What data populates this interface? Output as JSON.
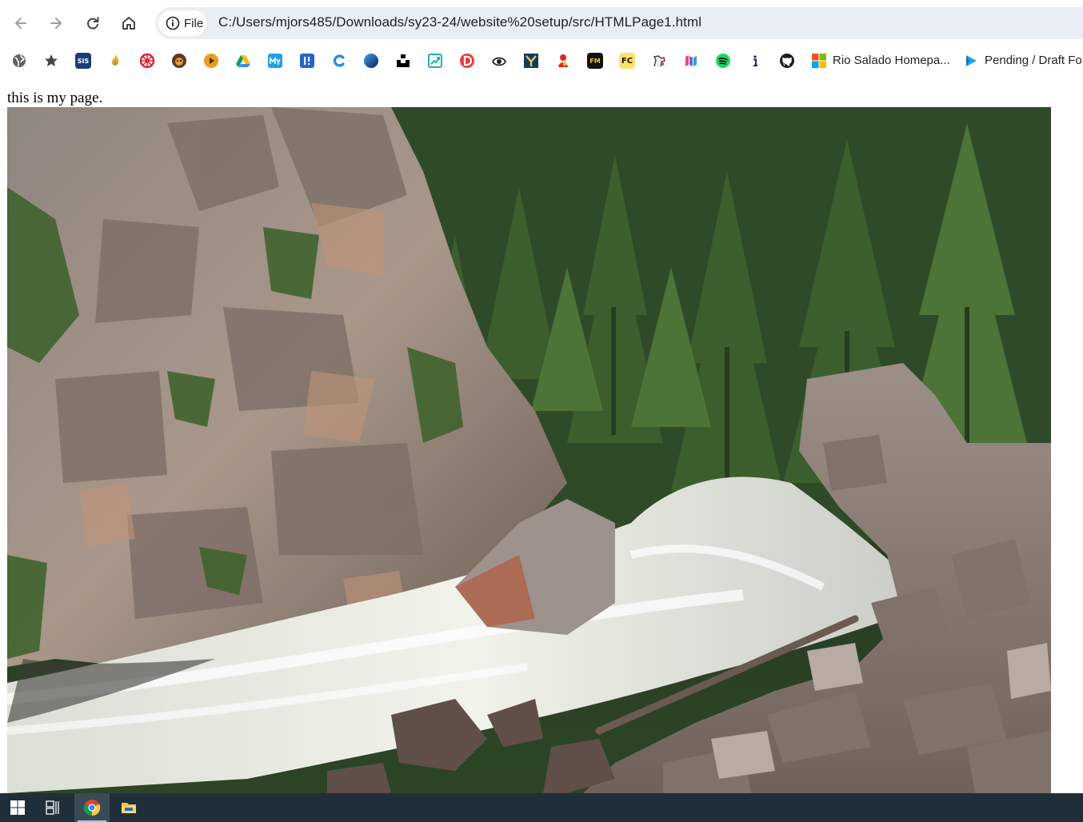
{
  "browser": {
    "nav": {
      "back_icon": "arrow-left-icon",
      "forward_icon": "arrow-right-icon",
      "reload_icon": "reload-icon",
      "home_icon": "home-icon"
    },
    "omnibox": {
      "chip_icon": "info-icon",
      "chip_label": "File",
      "url": "C:/Users/mjors485/Downloads/sy23-24/website%20setup/src/HTMLPage1.html"
    },
    "bookmarks": {
      "icons": [
        "globe-icon",
        "star-icon",
        "sis-icon",
        "flame-icon",
        "wheel-icon",
        "dog-icon",
        "play-icon",
        "google-drive-icon",
        "my-icon",
        "i-icon",
        "c-icon",
        "blue-circle-icon",
        "unsplash-icon",
        "chart-icon",
        "d-icon",
        "eye-icon",
        "y-icon",
        "red-figure-icon",
        "fm-icon",
        "fc-icon",
        "horse-icon",
        "m-icon",
        "spotify-icon",
        "info-icon",
        "github-icon"
      ],
      "sis_label": "SIS",
      "fm_label": "FM",
      "fc_label": "FC",
      "rio_label": "Rio Salado Homepa...",
      "pending_label": "Pending / Draft Fo"
    }
  },
  "page": {
    "text": "this is my page.",
    "image": "mountain-river-photo"
  },
  "taskbar": {
    "items": [
      "windows-start-icon",
      "task-view-icon",
      "chrome-icon",
      "file-explorer-icon"
    ],
    "active": "chrome-icon"
  }
}
